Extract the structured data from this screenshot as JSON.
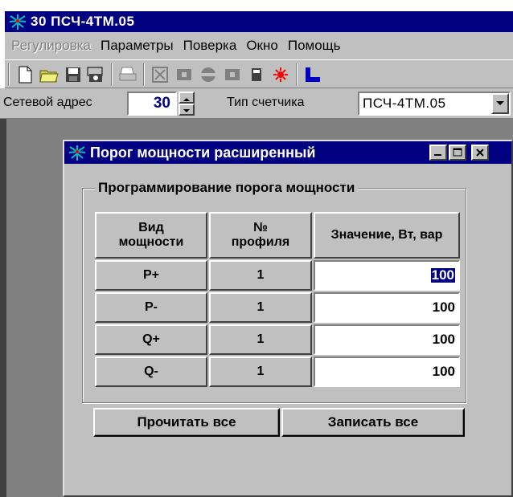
{
  "main_window": {
    "title": "30  ПСЧ-4ТМ.05"
  },
  "menu": {
    "items": [
      {
        "label": "Регулировка",
        "enabled": false
      },
      {
        "label": "Параметры",
        "enabled": true
      },
      {
        "label": "Поверка",
        "enabled": true
      },
      {
        "label": "Окно",
        "enabled": true
      },
      {
        "label": "Помощь",
        "enabled": true
      }
    ]
  },
  "toolbar": {
    "buttons": [
      "new-file-icon",
      "open-folder-icon",
      "save-icon",
      "camera-icon",
      "print-icon",
      "tool-cross-icon",
      "tool-left-icon",
      "tool-circle-icon",
      "tool-right-icon",
      "calculator-icon",
      "red-burst-icon",
      "chart-icon"
    ]
  },
  "address_bar": {
    "network_address_label": "Сетевой адрес",
    "network_address_value": "30",
    "meter_type_label": "Тип счетчика",
    "meter_type_value": "ПСЧ-4ТМ.05"
  },
  "dialog": {
    "title": "Порог мощности расширенный",
    "group_caption": "Программирование порога мощности",
    "columns": [
      "Вид мощности",
      "№ профиля",
      "Значение, Вт, вар"
    ],
    "rows": [
      {
        "type": "P+",
        "profile": "1",
        "value": "100"
      },
      {
        "type": "P-",
        "profile": "1",
        "value": "100"
      },
      {
        "type": "Q+",
        "profile": "1",
        "value": "100"
      },
      {
        "type": "Q-",
        "profile": "1",
        "value": "100"
      }
    ],
    "read_all_label": "Прочитать все",
    "write_all_label": "Записать все"
  },
  "colors": {
    "titlebar": "#000080",
    "face": "#c0c0c0",
    "mdi_background": "#808080",
    "selection": "#000080"
  }
}
